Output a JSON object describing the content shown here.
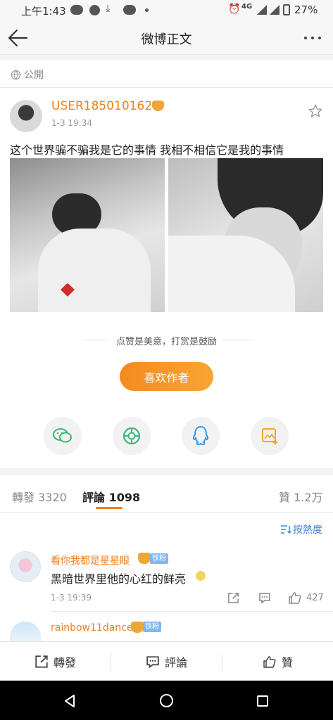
{
  "status": {
    "time": "上午1:43",
    "network": "4G",
    "battery": "27%"
  },
  "header": {
    "title": "微博正文"
  },
  "visibility": {
    "label": "公開"
  },
  "post": {
    "username": "USER1850101627",
    "date": "1-3 19:34",
    "text": "这个世界骗不骗我是它的事情 我相不相信它是我的事情"
  },
  "reward": {
    "hint": "点赞是美意，打赏是鼓励",
    "button": "喜欢作者"
  },
  "share_icons": [
    "wechat-icon",
    "moments-icon",
    "qq-icon",
    "save-image-icon"
  ],
  "tabs": {
    "repost": "轉發 3320",
    "comments": "評論 1098",
    "likes": "贊 1.2万"
  },
  "sort": {
    "label": "按熱度"
  },
  "comments": [
    {
      "name": "看你我都是星星眼",
      "badge": "铁粉",
      "text": "黑暗世界里他的心红的鲜亮",
      "date": "1-3 19:39",
      "likes": "427"
    },
    {
      "name": "rainbow11dance",
      "badge": "铁粉"
    }
  ],
  "bottom": {
    "repost": "轉發",
    "comment": "評論",
    "like": "贊"
  },
  "colors": {
    "accent": "#f07e1d",
    "link_blue": "#3b87d4"
  }
}
